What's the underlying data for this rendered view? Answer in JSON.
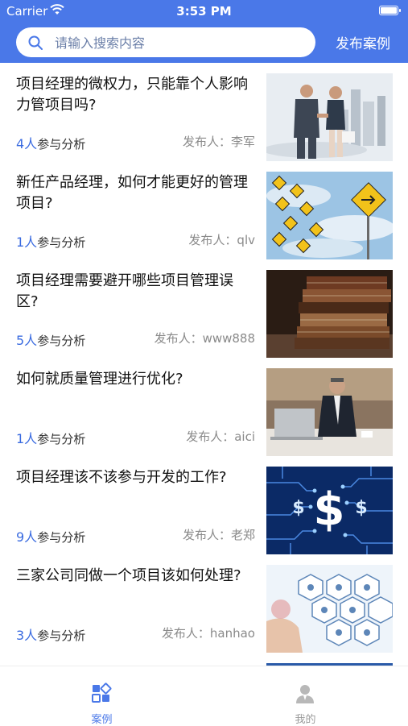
{
  "status": {
    "carrier": "Carrier",
    "time": "3:53 PM"
  },
  "search": {
    "placeholder": "请输入搜索内容"
  },
  "header": {
    "publish_label": "发布案例"
  },
  "cases": [
    {
      "title": "项目经理的微权力，只能靠个人影响力管项目吗?",
      "count": "4人",
      "count_suffix": "参与分析",
      "publisher": "发布人：李军"
    },
    {
      "title": "新任产品经理，如何才能更好的管理项目?",
      "count": "1人",
      "count_suffix": "参与分析",
      "publisher": "发布人：qlv"
    },
    {
      "title": "项目经理需要避开哪些项目管理误区?",
      "count": "5人",
      "count_suffix": "参与分析",
      "publisher": "发布人：www888"
    },
    {
      "title": "如何就质量管理进行优化?",
      "count": "1人",
      "count_suffix": "参与分析",
      "publisher": "发布人：aici"
    },
    {
      "title": "项目经理该不该参与开发的工作?",
      "count": "9人",
      "count_suffix": "参与分析",
      "publisher": "发布人：老郑"
    },
    {
      "title": "三家公司同做一个项目该如何处理?",
      "count": "3人",
      "count_suffix": "参与分析",
      "publisher": "发布人：hanhao"
    }
  ],
  "tabs": [
    {
      "label": "案例",
      "active": true
    },
    {
      "label": "我的",
      "active": false
    }
  ],
  "colors": {
    "accent": "#4a78e8",
    "count_blue": "#3a6be0",
    "inactive_tab": "#9a9a9a"
  }
}
